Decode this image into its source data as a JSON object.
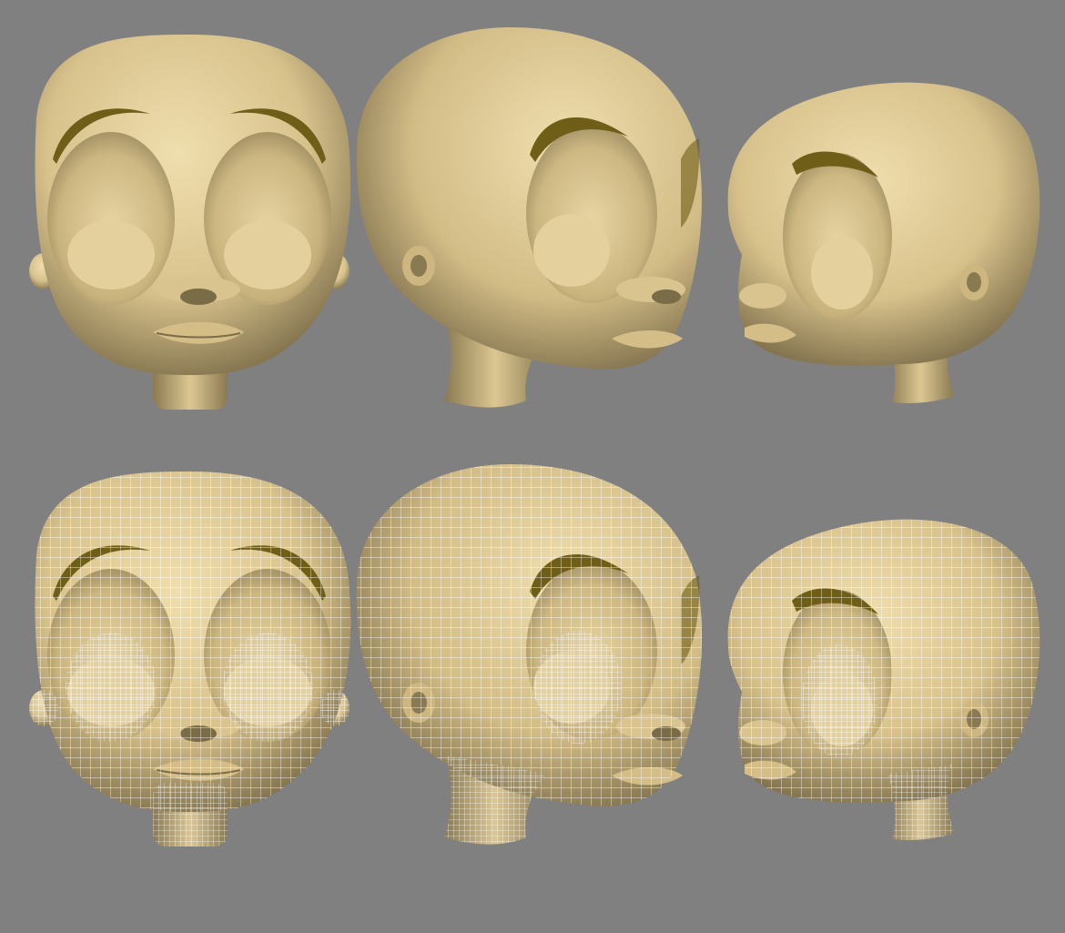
{
  "scene": {
    "background_color": "#808080",
    "skin_color": "#e6d3a0",
    "skin_shadow_color": "#6b5e3e",
    "brow_color": "#6e5e17",
    "wire_color": "#ffffff"
  },
  "rows": [
    {
      "render_mode": "smooth-shaded",
      "views": [
        {
          "angle": "front"
        },
        {
          "angle": "three-quarter"
        },
        {
          "angle": "profile"
        }
      ]
    },
    {
      "render_mode": "wireframe-on-shaded",
      "views": [
        {
          "angle": "front"
        },
        {
          "angle": "three-quarter"
        },
        {
          "angle": "profile"
        }
      ]
    }
  ]
}
